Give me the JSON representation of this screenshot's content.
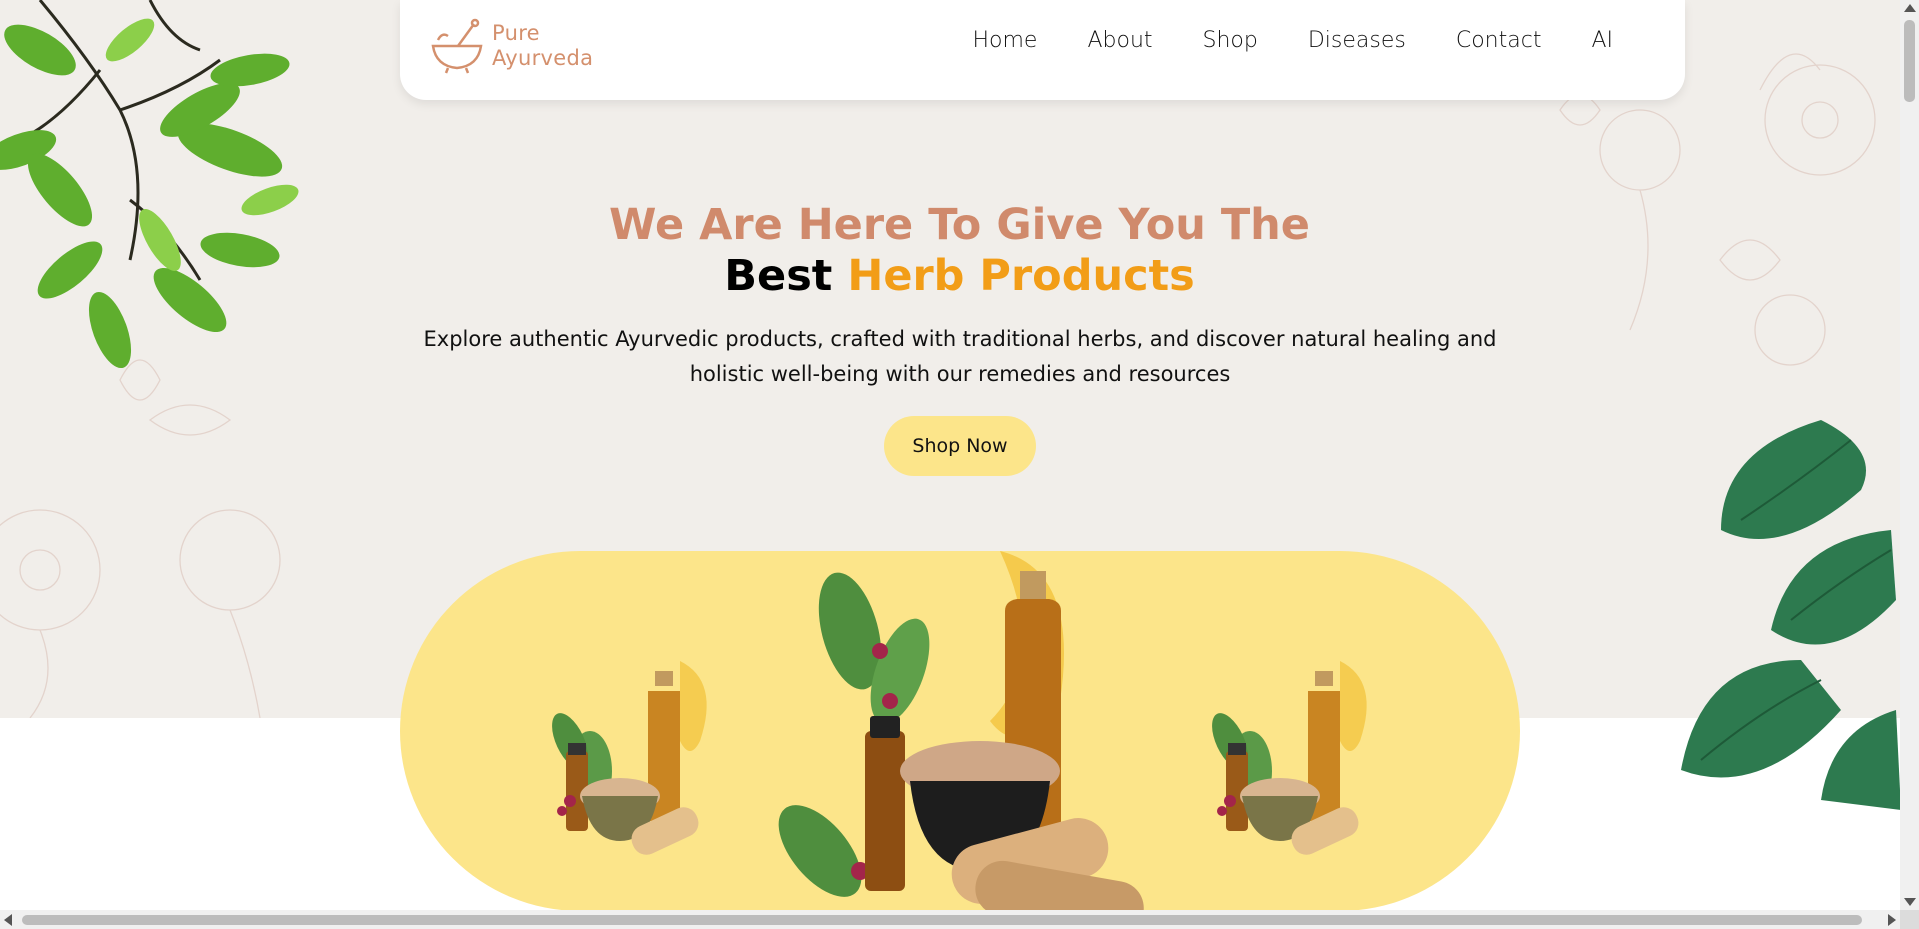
{
  "brand": {
    "line1": "Pure",
    "line2": "Ayurveda",
    "color": "#d4906d",
    "icon": "mortar-pestle-icon"
  },
  "nav": {
    "items": [
      {
        "label": "Home"
      },
      {
        "label": "About"
      },
      {
        "label": "Shop"
      },
      {
        "label": "Diseases"
      },
      {
        "label": "Contact"
      },
      {
        "label": "AI"
      }
    ]
  },
  "hero": {
    "headline_line1": "We Are Here To Give You The",
    "headline_best": "Best",
    "headline_highlight": "Herb Products",
    "description": "Explore authentic Ayurvedic products, crafted with traditional herbs, and discover natural healing and holistic well-being with our remedies and resources",
    "cta_label": "Shop Now"
  },
  "colors": {
    "hero_background": "#f1eeea",
    "headline_primary": "#d08a6c",
    "headline_highlight": "#f29d17",
    "button": "#fce58a",
    "product_banner": "#fce58a"
  },
  "decorations": [
    "leafy-branch-image",
    "monstera-leaves-image",
    "herbal-products-image"
  ]
}
